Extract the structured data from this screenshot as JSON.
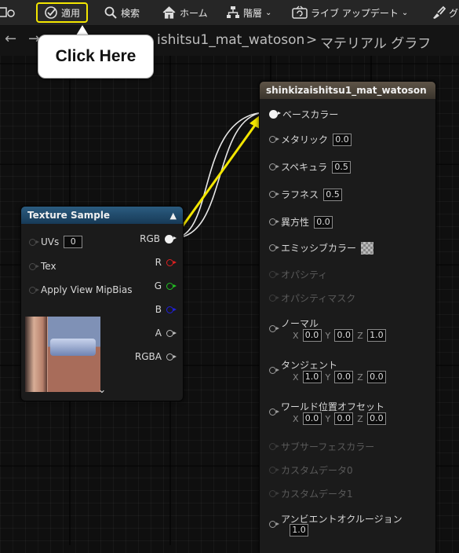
{
  "toolbar": {
    "apply_label": "適用",
    "search_label": "検索",
    "home_label": "ホーム",
    "hierarchy_label": "階層",
    "live_update_label": "ライブ アップデート",
    "extra_label": "グ"
  },
  "breadcrumb": {
    "material_name": "ishitsu1_mat_watoson",
    "separator": ">",
    "graph_label": "マテリアル グラフ"
  },
  "callout": {
    "text": "Click Here"
  },
  "texture_node": {
    "title": "Texture Sample",
    "inputs": [
      {
        "label": "UVs",
        "value": "0"
      },
      {
        "label": "Tex"
      },
      {
        "label": "Apply View MipBias"
      }
    ],
    "outputs": [
      {
        "label": "RGB",
        "color": "#f2f2f2"
      },
      {
        "label": "R",
        "color": "#e02020"
      },
      {
        "label": "G",
        "color": "#22c022"
      },
      {
        "label": "B",
        "color": "#2020e0"
      },
      {
        "label": "A",
        "color": "#bbbbbb"
      },
      {
        "label": "RGBA",
        "color": "#bbbbbb"
      }
    ],
    "expand_icon": "chevron-down-icon"
  },
  "material_node": {
    "title": "shinkizaishitsu1_mat_watoson",
    "pins": [
      {
        "label": "ベースカラー"
      },
      {
        "label": "メタリック",
        "value": "0.0"
      },
      {
        "label": "スペキュラ",
        "value": "0.5"
      },
      {
        "label": "ラフネス",
        "value": "0.5"
      },
      {
        "label": "異方性",
        "value": "0.0"
      },
      {
        "label": "エミッシブカラー"
      },
      {
        "label": "オパシティ"
      },
      {
        "label": "オパシティマスク"
      },
      {
        "label": "ノーマル",
        "x": "0.0",
        "y": "0.0",
        "z": "1.0"
      },
      {
        "label": "タンジェント",
        "x": "1.0",
        "y": "0.0",
        "z": "0.0"
      },
      {
        "label": "ワールド位置オフセット",
        "x": "0.0",
        "y": "0.0",
        "z": "0.0"
      },
      {
        "label": "サブサーフェスカラー"
      },
      {
        "label": "カスタムデータ0"
      },
      {
        "label": "カスタムデータ1"
      },
      {
        "label": "アンビエントオクルージョン",
        "value": "1.0"
      }
    ],
    "axis": {
      "x": "X",
      "y": "Y",
      "z": "Z"
    }
  },
  "colors": {
    "highlight": "#f3e600",
    "wire": "#e8e8e8"
  }
}
